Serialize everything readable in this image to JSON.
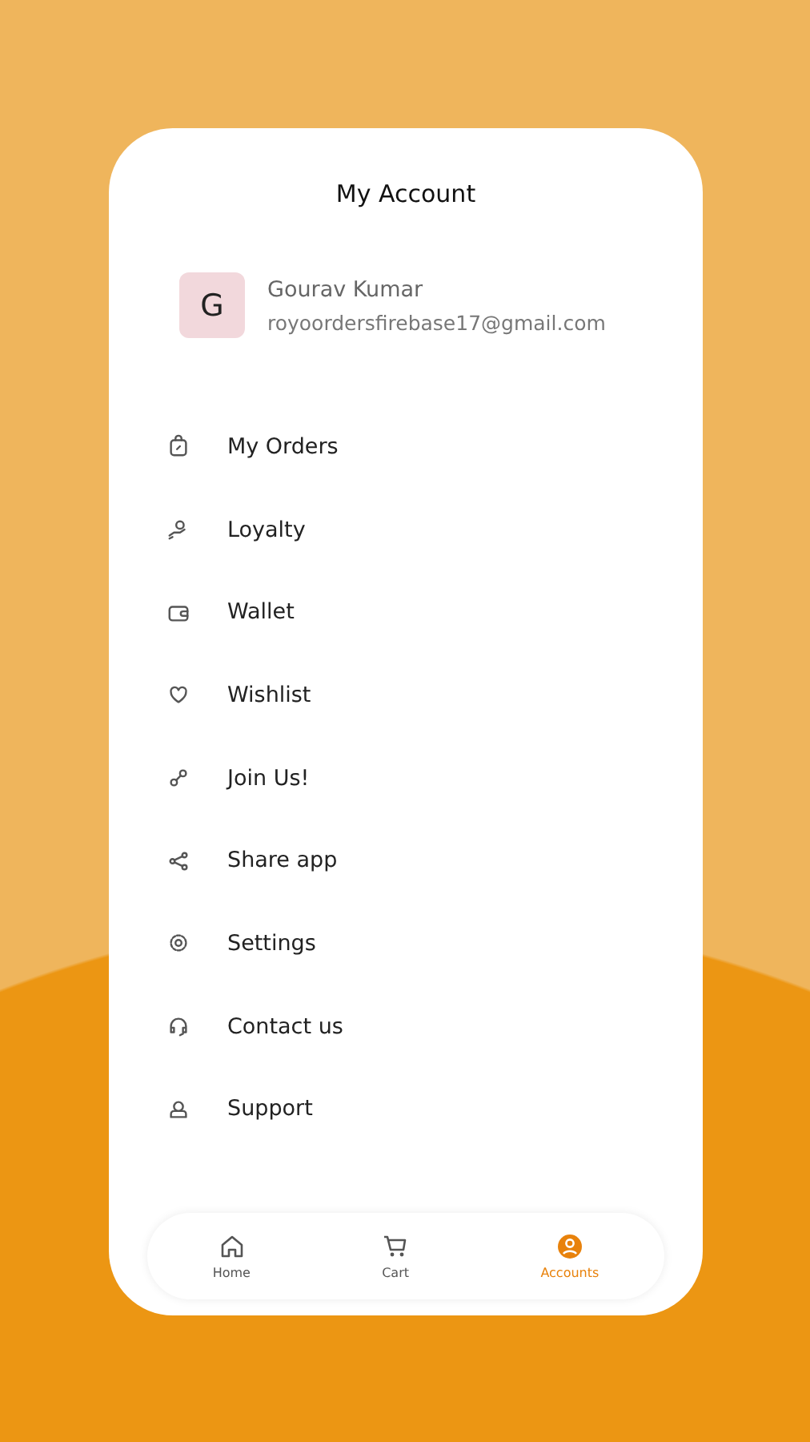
{
  "header": {
    "title": "My Account"
  },
  "profile": {
    "initial": "G",
    "name": "Gourav Kumar",
    "email": "royoordersfirebase17@gmail.com"
  },
  "menu": [
    {
      "label": "My Orders"
    },
    {
      "label": "Loyalty"
    },
    {
      "label": "Wallet"
    },
    {
      "label": "Wishlist"
    },
    {
      "label": "Join Us!"
    },
    {
      "label": "Share app"
    },
    {
      "label": "Settings"
    },
    {
      "label": "Contact us"
    },
    {
      "label": "Support"
    }
  ],
  "bottom_nav": [
    {
      "label": "Home",
      "selected": false
    },
    {
      "label": "Cart",
      "selected": false
    },
    {
      "label": "Accounts",
      "selected": true
    }
  ]
}
